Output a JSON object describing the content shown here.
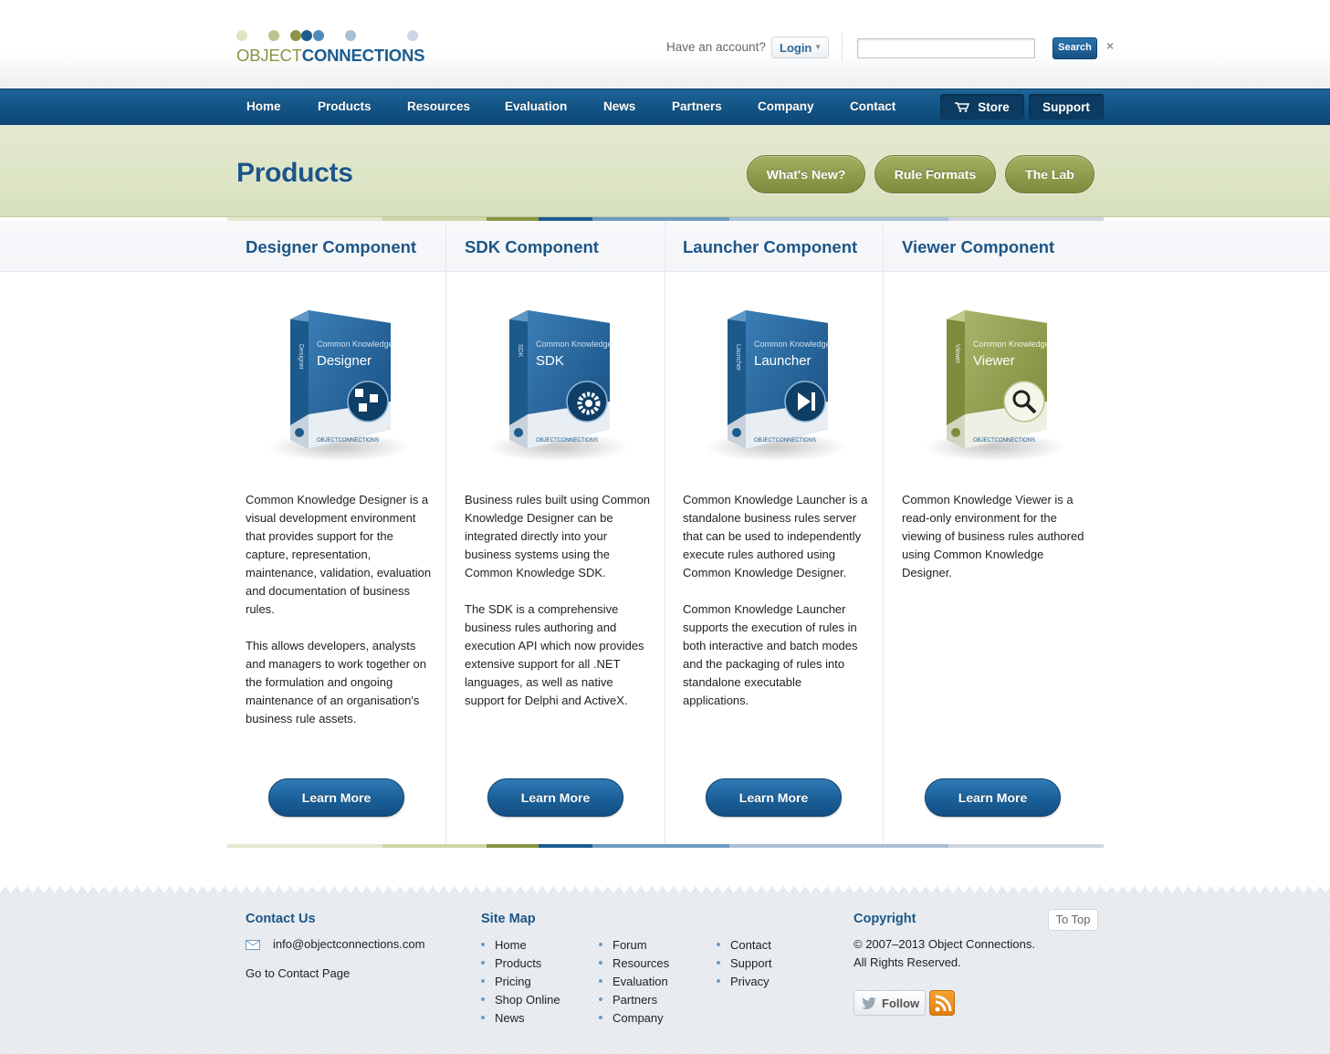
{
  "brand": {
    "word1": "OBJECT",
    "word2": "CONNECTIONS",
    "dot_colors": [
      "#dde6c3",
      "#b9c58e",
      "#8a9444",
      "#1b5c8e",
      "#4f8bb9",
      "#a9bfd6",
      "#cbd6e4"
    ]
  },
  "header": {
    "account_text": "Have an account?",
    "login_label": "Login",
    "search_placeholder": "",
    "search_value": "",
    "search_button": "Search",
    "close_glyph": "×"
  },
  "nav": {
    "items": [
      "Home",
      "Products",
      "Resources",
      "Evaluation",
      "News",
      "Partners",
      "Company",
      "Contact"
    ],
    "store": "Store",
    "support": "Support"
  },
  "page": {
    "title": "Products",
    "pills": [
      "What's New?",
      "Rule Formats",
      "The Lab"
    ]
  },
  "colors": {
    "primary_blue": "#1d5687",
    "olive": "#8f9a4c",
    "stripe": [
      "#e3e9cf",
      "#cdd6a6",
      "#8a9444",
      "#1b5c8e",
      "#6f9bc0",
      "#a9bfd6",
      "#cfd6df"
    ]
  },
  "products": [
    {
      "title": "Designer Component",
      "box_brand": "Common Knowledge",
      "box_name": "Designer",
      "box_spine": "Designer",
      "box_icon": "diagram-icon",
      "paragraphs": [
        "Common Knowledge Designer is a visual development environment that provides support for the capture, representation, maintenance, validation, evaluation and documentation of business rules.",
        "This allows developers, analysts and managers to work together on the formulation and ongoing maintenance of an organisation's business rule assets."
      ],
      "button": "Learn More"
    },
    {
      "title": "SDK Component",
      "box_brand": "Common Knowledge",
      "box_name": "SDK",
      "box_spine": "SDK",
      "box_icon": "gear-icon",
      "paragraphs": [
        "Business rules built using Common Knowledge Designer can be integrated directly into your business systems using the Common Knowledge SDK.",
        "The SDK is a comprehensive business rules authoring and execution API which now provides extensive support for all .NET languages, as well as native support for Delphi and ActiveX."
      ],
      "button": "Learn More"
    },
    {
      "title": "Launcher Component",
      "box_brand": "Common Knowledge",
      "box_name": "Launcher",
      "box_spine": "Launcher",
      "box_icon": "play-icon",
      "paragraphs": [
        "Common Knowledge Launcher is a standalone business rules server that can be used to independently execute rules authored using Common Knowledge Designer.",
        "Common Knowledge Launcher supports the execution of rules in both interactive and batch modes and the packaging of rules into standalone executable applications."
      ],
      "button": "Learn More"
    },
    {
      "title": "Viewer Component",
      "box_brand": "Common Knowledge",
      "box_name": "Viewer",
      "box_spine": "Viewer",
      "box_icon": "magnifier-icon",
      "paragraphs": [
        "Common Knowledge Viewer is a read-only environment for the viewing of business rules authored using Common Knowledge Designer."
      ],
      "button": "Learn More"
    }
  ],
  "footer": {
    "contact_title": "Contact Us",
    "email": "info@objectconnections.com",
    "contact_link": "Go to Contact Page",
    "sitemap_title": "Site Map",
    "sitemap_cols": [
      [
        "Home",
        "Products",
        "Pricing",
        "Shop Online",
        "News"
      ],
      [
        "Forum",
        "Resources",
        "Evaluation",
        "Partners",
        "Company"
      ],
      [
        "Contact",
        "Support",
        "Privacy"
      ]
    ],
    "copyright_title": "Copyright",
    "copyright_line1": "© 2007–2013 Object Connections.",
    "copyright_line2": "All Rights Reserved.",
    "to_top": "To Top",
    "follow": "Follow"
  }
}
